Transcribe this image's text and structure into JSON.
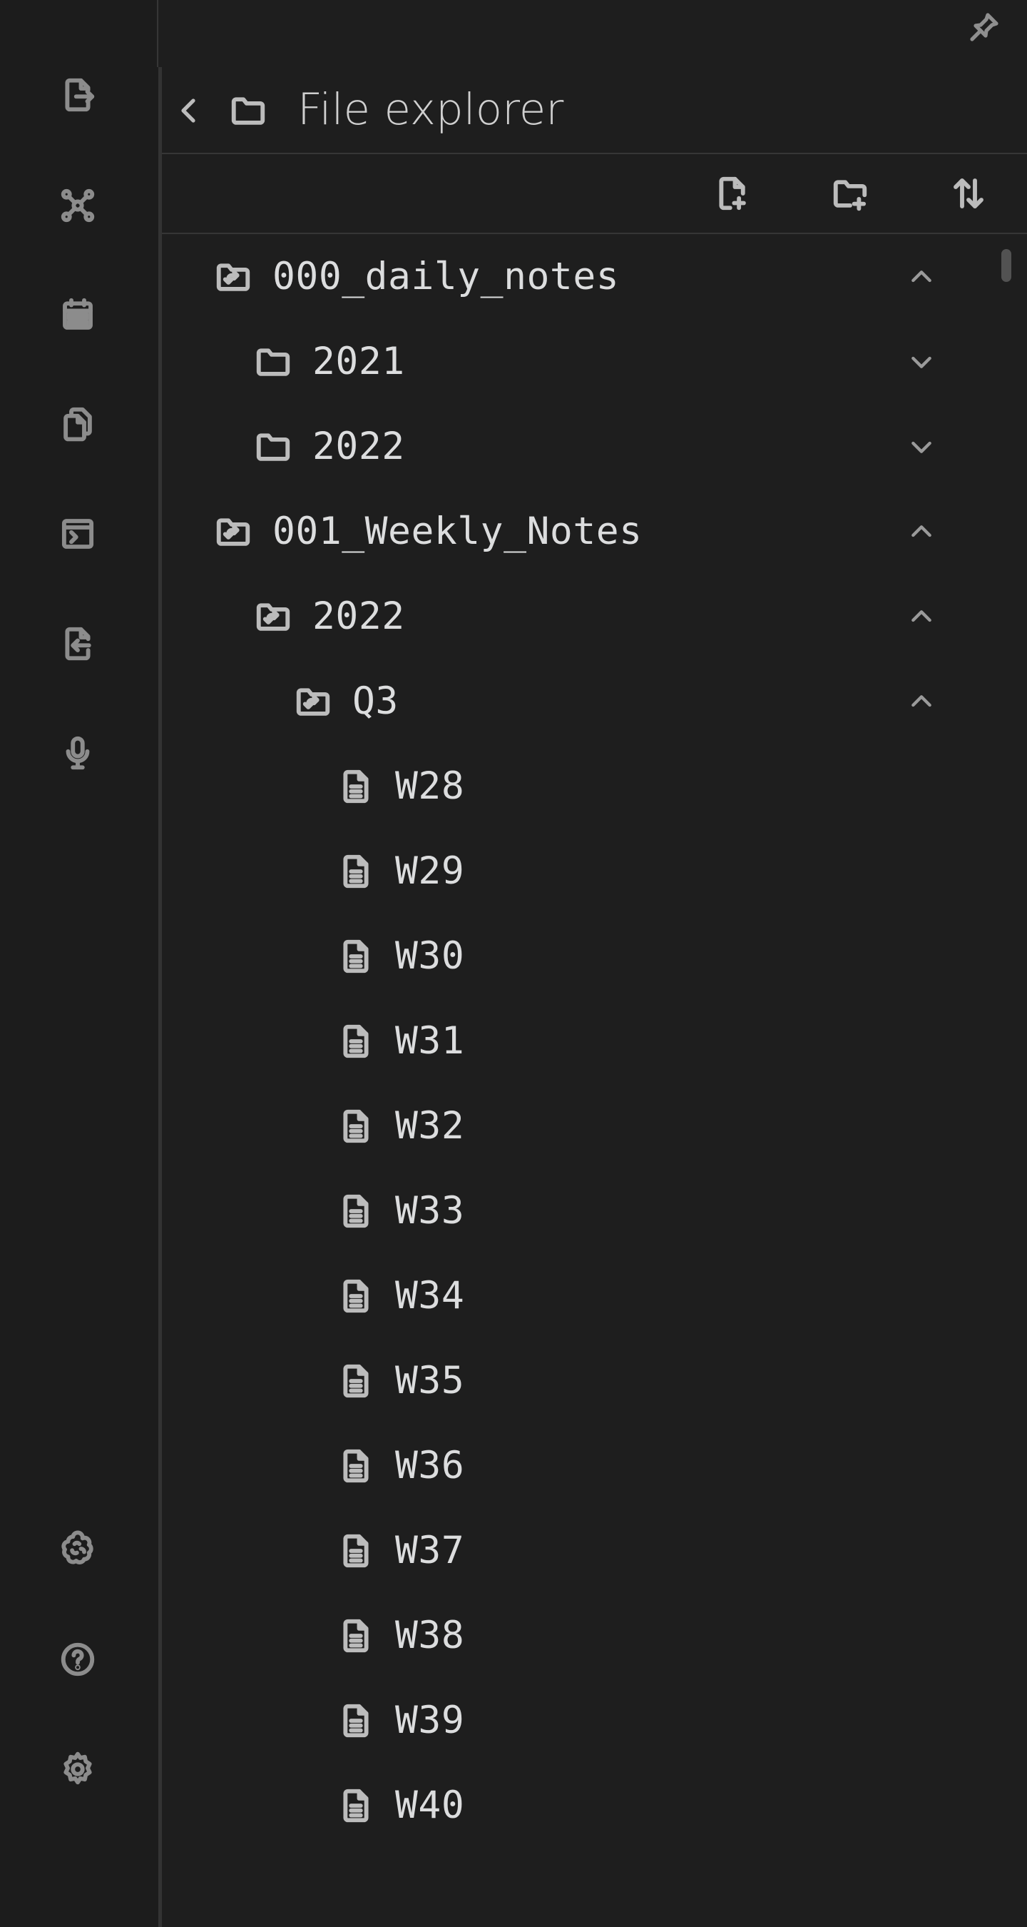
{
  "ribbon": {
    "top_icons": [
      {
        "icon": "file-export-icon",
        "name": "ribbon-open-quick-switcher"
      },
      {
        "icon": "graph-view-icon",
        "name": "ribbon-graph-view"
      },
      {
        "icon": "calendar-icon",
        "name": "ribbon-daily-note"
      },
      {
        "icon": "copy-files-icon",
        "name": "ribbon-templates"
      },
      {
        "icon": "terminal-window-icon",
        "name": "ribbon-command-palette"
      },
      {
        "icon": "file-import-icon",
        "name": "ribbon-import"
      },
      {
        "icon": "microphone-icon",
        "name": "ribbon-audio-recorder"
      }
    ],
    "bottom_icons": [
      {
        "icon": "brain-icon",
        "name": "ribbon-vault-switch"
      },
      {
        "icon": "help-circle-icon",
        "name": "ribbon-help"
      },
      {
        "icon": "gear-icon",
        "name": "ribbon-settings"
      }
    ]
  },
  "panel": {
    "title": "File explorer",
    "pin_icon": "pin-icon",
    "back_icon": "chevron-left-icon",
    "header_icon": "folder-icon",
    "toolbar": [
      {
        "icon": "new-note-icon",
        "name": "new-note-button"
      },
      {
        "icon": "new-folder-icon",
        "name": "new-folder-button"
      },
      {
        "icon": "sort-icon",
        "name": "sort-button"
      }
    ]
  },
  "tree": {
    "items": [
      {
        "label": "000_daily_notes",
        "type": "folder-open",
        "depth": 0,
        "expanded": true
      },
      {
        "label": "2021",
        "type": "folder",
        "depth": 1,
        "expanded": false
      },
      {
        "label": "2022",
        "type": "folder",
        "depth": 1,
        "expanded": false
      },
      {
        "label": "001_Weekly_Notes",
        "type": "folder-open",
        "depth": 0,
        "expanded": true
      },
      {
        "label": "2022",
        "type": "folder-open",
        "depth": 1,
        "expanded": true
      },
      {
        "label": "Q3",
        "type": "folder-open",
        "depth": 2,
        "expanded": true
      },
      {
        "label": "W28",
        "type": "file",
        "depth": 3
      },
      {
        "label": "W29",
        "type": "file",
        "depth": 3
      },
      {
        "label": "W30",
        "type": "file",
        "depth": 3
      },
      {
        "label": "W31",
        "type": "file",
        "depth": 3
      },
      {
        "label": "W32",
        "type": "file",
        "depth": 3
      },
      {
        "label": "W33",
        "type": "file",
        "depth": 3
      },
      {
        "label": "W34",
        "type": "file",
        "depth": 3
      },
      {
        "label": "W35",
        "type": "file",
        "depth": 3
      },
      {
        "label": "W36",
        "type": "file",
        "depth": 3
      },
      {
        "label": "W37",
        "type": "file",
        "depth": 3
      },
      {
        "label": "W38",
        "type": "file",
        "depth": 3
      },
      {
        "label": "W39",
        "type": "file",
        "depth": 3
      },
      {
        "label": "W40",
        "type": "file",
        "depth": 3
      }
    ]
  },
  "colors": {
    "background": "#1e1e1e",
    "ribbon": "#1c1c1c",
    "text": "#dcddde",
    "icon": "#bcbcbc",
    "divider": "#363636"
  }
}
